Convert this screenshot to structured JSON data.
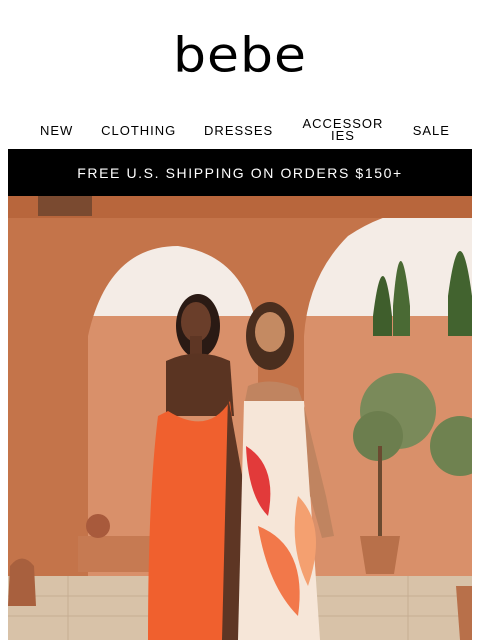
{
  "brand": {
    "logo_text": "bebe"
  },
  "nav": {
    "items": [
      {
        "label": "NEW"
      },
      {
        "label": "CLOTHING"
      },
      {
        "label": "DRESSES"
      },
      {
        "label": "ACCESSORIES"
      },
      {
        "label": "SALE"
      }
    ]
  },
  "promo": {
    "text": "FREE U.S. SHIPPING ON ORDERS $150+"
  },
  "colors": {
    "banner_bg": "#000000",
    "terracotta": "#c87850",
    "orange_dress": "#f0602e"
  }
}
